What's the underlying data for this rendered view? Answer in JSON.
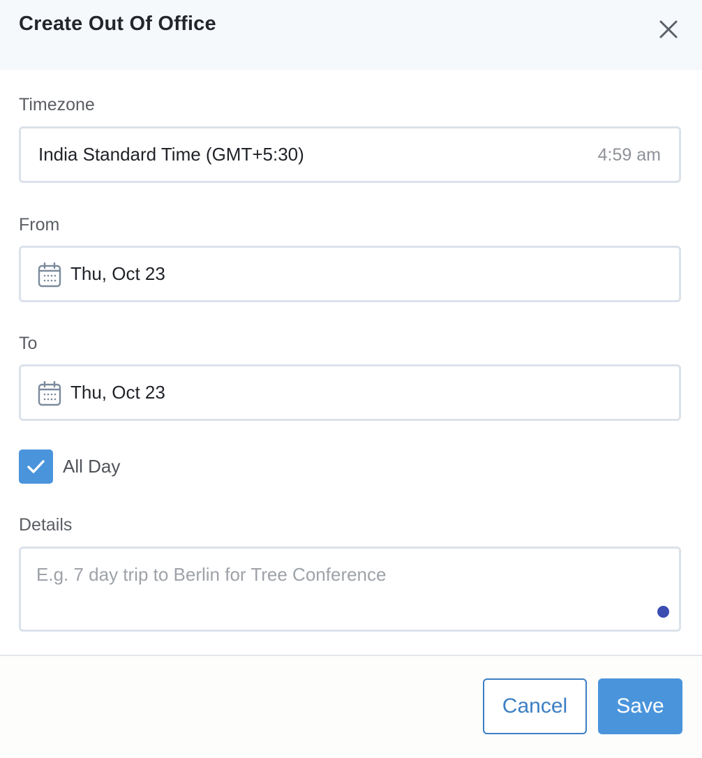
{
  "dialog": {
    "title": "Create Out Of Office",
    "close_icon": "close-icon"
  },
  "timezone": {
    "label": "Timezone",
    "value": "India Standard Time (GMT+5:30)",
    "current_time": "4:59 am"
  },
  "from": {
    "label": "From",
    "value": "Thu, Oct 23",
    "icon": "calendar-icon"
  },
  "to": {
    "label": "To",
    "value": "Thu, Oct 23",
    "icon": "calendar-icon"
  },
  "all_day": {
    "label": "All Day",
    "checked": true
  },
  "details": {
    "label": "Details",
    "placeholder": "E.g. 7 day trip to Berlin for Tree Conference",
    "value": ""
  },
  "actions": {
    "cancel_label": "Cancel",
    "save_label": "Save"
  },
  "colors": {
    "accent": "#4a94dc",
    "header_bg": "#f5f9fc",
    "border": "#dbe2ea",
    "indicator_dot": "#3b4db1"
  }
}
